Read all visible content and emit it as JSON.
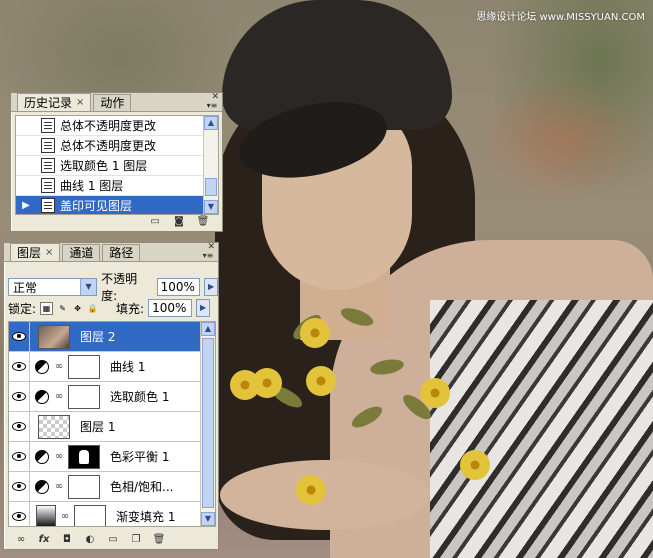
{
  "watermark": "思缘设计论坛 www.MISSYUAN.COM",
  "history_panel": {
    "tabs": [
      {
        "label": "历史记录",
        "active": true
      },
      {
        "label": "动作",
        "active": false
      }
    ],
    "items": [
      {
        "label": "总体不透明度更改",
        "selected": false
      },
      {
        "label": "总体不透明度更改",
        "selected": false
      },
      {
        "label": "选取颜色 1 图层",
        "selected": false
      },
      {
        "label": "曲线 1 图层",
        "selected": false
      },
      {
        "label": "盖印可见图层",
        "selected": true
      }
    ],
    "footer_icons": [
      "new-document-icon",
      "camera-icon",
      "trash-icon"
    ]
  },
  "layers_panel": {
    "tabs": [
      {
        "label": "图层",
        "active": true
      },
      {
        "label": "通道",
        "active": false
      },
      {
        "label": "路径",
        "active": false
      }
    ],
    "blend_mode": "正常",
    "opacity_label": "不透明度:",
    "opacity_value": "100%",
    "lock_label": "锁定:",
    "fill_label": "填充:",
    "fill_value": "100%",
    "layers": [
      {
        "name": "图层 2",
        "type": "photo",
        "selected": true
      },
      {
        "name": "曲线 1",
        "type": "adjustment",
        "mask": "white"
      },
      {
        "name": "选取颜色 1",
        "type": "adjustment",
        "mask": "white"
      },
      {
        "name": "图层 1",
        "type": "checker"
      },
      {
        "name": "色彩平衡 1",
        "type": "adjustment",
        "mask": "shape"
      },
      {
        "name": "色相/饱和...",
        "type": "adjustment",
        "mask": "white"
      },
      {
        "name": "渐变填充 1",
        "type": "gradient",
        "mask": "white"
      }
    ]
  },
  "colors": {
    "selection": "#316ac5",
    "panel": "#ece9d8"
  }
}
